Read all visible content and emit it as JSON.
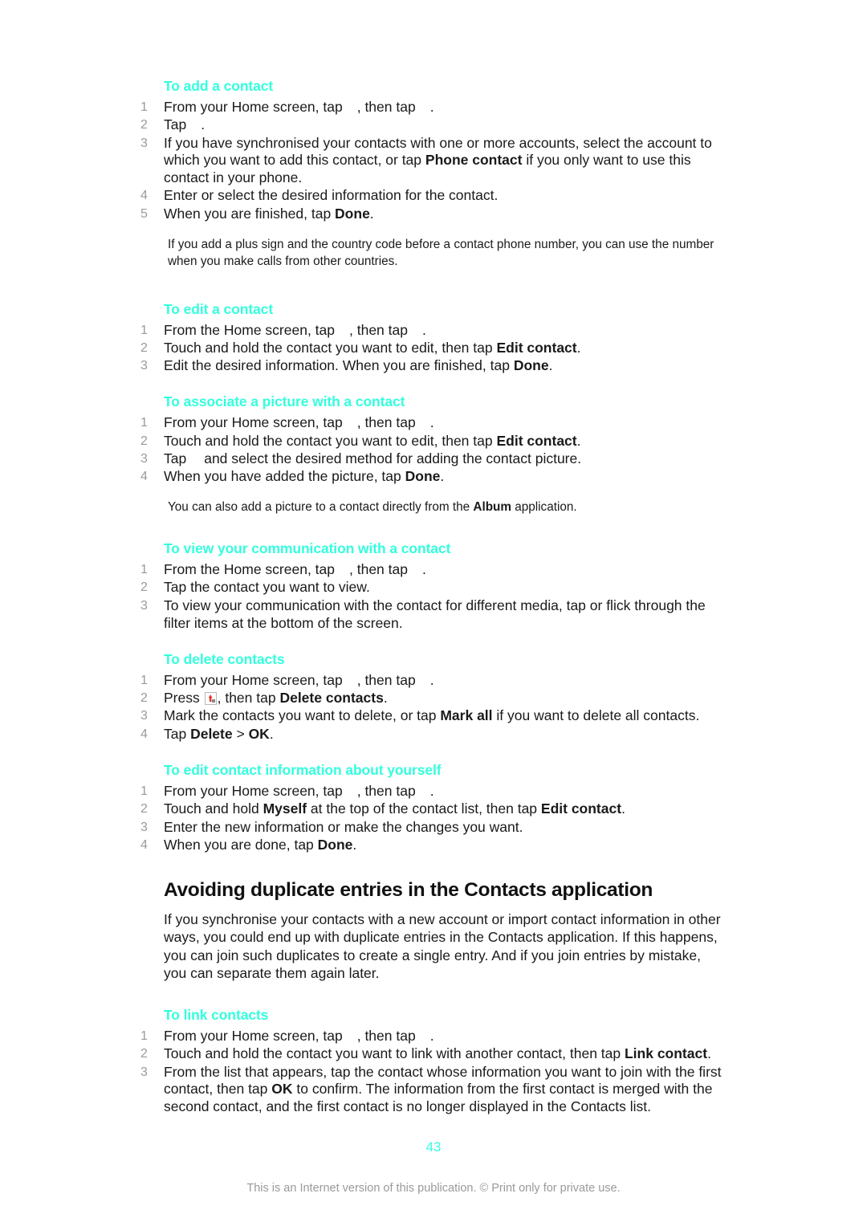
{
  "document": {
    "page_number": "43",
    "footer_note": "This is an Internet version of this publication. © Print only for private use."
  },
  "sections": [
    {
      "heading": "To add a contact",
      "steps": [
        {
          "num": "1",
          "parts": [
            {
              "t": "text",
              "v": "From your Home screen, tap "
            },
            {
              "t": "gap"
            },
            {
              "t": "text",
              "v": ", then tap "
            },
            {
              "t": "gap"
            },
            {
              "t": "text",
              "v": "."
            }
          ],
          "plain": "From your Home screen, tap , then tap ."
        },
        {
          "num": "2",
          "plain": "Tap ."
        },
        {
          "num": "3",
          "plain": "If you have synchronised your contacts with one or more accounts, select the account to which you want to add this contact, or tap Phone contact if you only want to use this contact in your phone.",
          "bold_terms": [
            "Phone contact"
          ]
        },
        {
          "num": "4",
          "plain": "Enter or select the desired information for the contact."
        },
        {
          "num": "5",
          "plain": "When you are finished, tap Done.",
          "bold_terms": [
            "Done"
          ]
        }
      ],
      "note": "If you add a plus sign and the country code before a contact phone number, you can use the number when you make calls from other countries."
    },
    {
      "heading": "To edit a contact",
      "steps": [
        {
          "num": "1",
          "plain": "From the Home screen, tap , then tap ."
        },
        {
          "num": "2",
          "plain": "Touch and hold the contact you want to edit, then tap Edit contact.",
          "bold_terms": [
            "Edit contact"
          ]
        },
        {
          "num": "3",
          "plain": "Edit the desired information. When you are finished, tap Done.",
          "bold_terms": [
            "Done"
          ]
        }
      ]
    },
    {
      "heading": "To associate a picture with a contact",
      "steps": [
        {
          "num": "1",
          "plain": "From your Home screen, tap , then tap ."
        },
        {
          "num": "2",
          "plain": "Touch and hold the contact you want to edit, then tap Edit contact.",
          "bold_terms": [
            "Edit contact"
          ]
        },
        {
          "num": "3",
          "plain": "Tap and select the desired method for adding the contact picture."
        },
        {
          "num": "4",
          "plain": "When you have added the picture, tap Done.",
          "bold_terms": [
            "Done"
          ]
        }
      ],
      "note": "You can also add a picture to a contact directly from the Album application.",
      "note_bold_terms": [
        "Album"
      ]
    },
    {
      "heading": "To view your communication with a contact",
      "steps": [
        {
          "num": "1",
          "plain": "From the Home screen, tap , then tap ."
        },
        {
          "num": "2",
          "plain": "Tap the contact you want to view."
        },
        {
          "num": "3",
          "plain": "To view your communication with the contact for different media, tap or flick through the filter items at the bottom of the screen."
        }
      ]
    },
    {
      "heading": "To delete contacts",
      "steps": [
        {
          "num": "1",
          "plain": "From your Home screen, tap , then tap ."
        },
        {
          "num": "2",
          "plain": "Press , then tap Delete contacts.",
          "bold_terms": [
            "Delete contacts"
          ],
          "has_icon": true
        },
        {
          "num": "3",
          "plain": "Mark the contacts you want to delete, or tap Mark all if you want to delete all contacts.",
          "bold_terms": [
            "Mark all"
          ]
        },
        {
          "num": "4",
          "plain": "Tap Delete > OK.",
          "bold_terms": [
            "Delete",
            "OK"
          ]
        }
      ]
    },
    {
      "heading": "To edit contact information about yourself",
      "steps": [
        {
          "num": "1",
          "plain": "From your Home screen, tap , then tap ."
        },
        {
          "num": "2",
          "plain": "Touch and hold Myself at the top of the contact list, then tap Edit contact.",
          "bold_terms": [
            "Myself",
            "Edit contact"
          ]
        },
        {
          "num": "3",
          "plain": "Enter the new information or make the changes you want."
        },
        {
          "num": "4",
          "plain": "When you are done, tap Done.",
          "bold_terms": [
            "Done"
          ]
        }
      ]
    }
  ],
  "major_section": {
    "heading": "Avoiding duplicate entries in the Contacts application",
    "body": "If you synchronise your contacts with a new account or import contact information in other ways, you could end up with duplicate entries in the Contacts application. If this happens, you can join such duplicates to create a single entry. And if you join entries by mistake, you can separate them again later.",
    "subsection": {
      "heading": "To link contacts",
      "steps": [
        {
          "num": "1",
          "plain": "From your Home screen, tap , then tap ."
        },
        {
          "num": "2",
          "plain": "Touch and hold the contact you want to link with another contact, then tap Link contact.",
          "bold_terms": [
            "Link contact"
          ]
        },
        {
          "num": "3",
          "plain": "From the list that appears, tap the contact whose information you want to join with the first contact, then tap OK to confirm. The information from the first contact is merged with the second contact, and the first contact is no longer displayed in the Contacts list.",
          "bold_terms": [
            "OK"
          ]
        }
      ]
    }
  },
  "colors": {
    "heading_cyan": "#33ffdd",
    "body_text": "#1a1a1a",
    "step_number": "#9a9a9a",
    "footer_text": "#9a9a9a",
    "icon_red": "#e2382a"
  }
}
